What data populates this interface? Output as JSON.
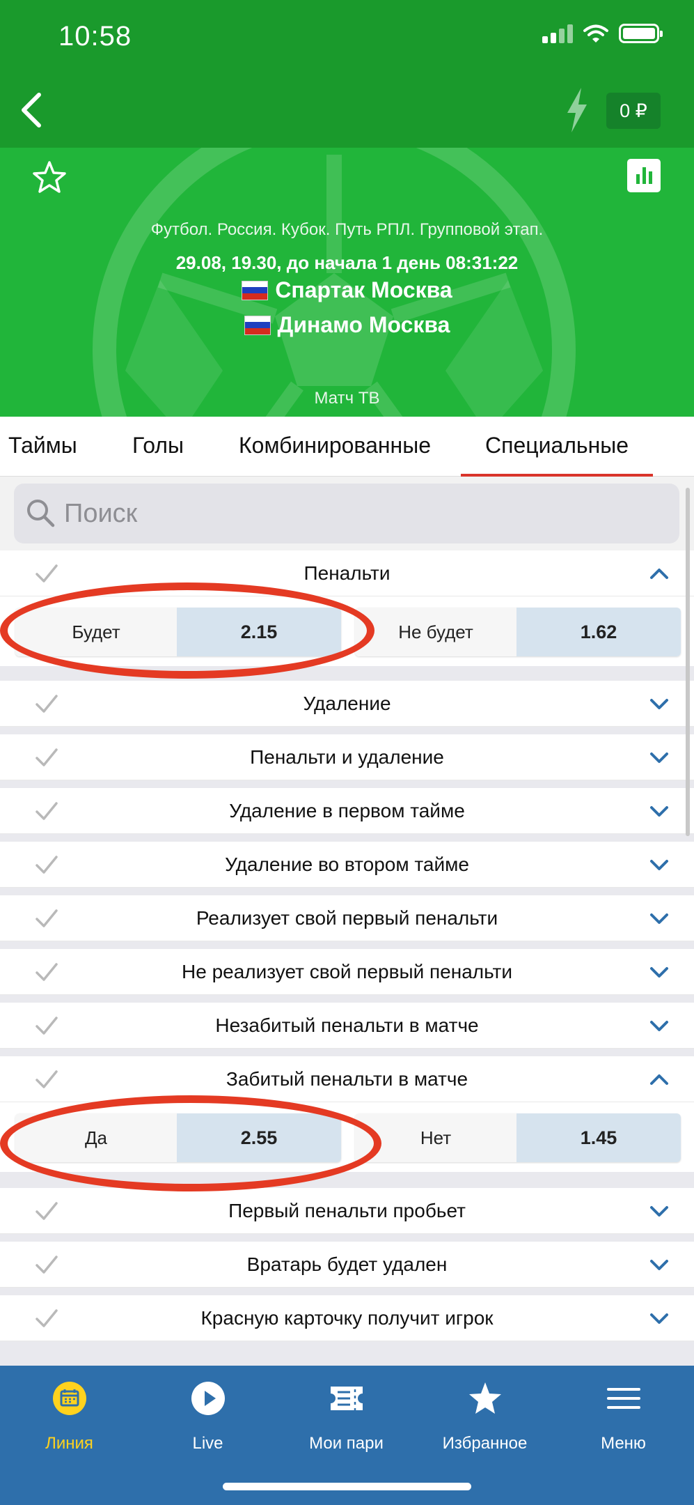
{
  "status_bar": {
    "time": "10:58"
  },
  "header": {
    "balance": "0 ₽"
  },
  "match": {
    "tournament": "Футбол. Россия. Кубок. Путь РПЛ. Групповой этап.",
    "datetime": "29.08, 19.30,  до начала 1 день 08:31:22",
    "team1": "Спартак Москва",
    "team2": "Динамо Москва",
    "tv": "Матч ТВ"
  },
  "tabs": [
    "Таймы",
    "Голы",
    "Комбинированные",
    "Специальные"
  ],
  "active_tab": "Специальные",
  "search": {
    "placeholder": "Поиск"
  },
  "markets": [
    {
      "title": "Пенальти",
      "expanded": true,
      "odds": [
        {
          "label": "Будет",
          "value": "2.15"
        },
        {
          "label": "Не будет",
          "value": "1.62"
        }
      ]
    },
    {
      "title": "Удаление",
      "expanded": false
    },
    {
      "title": "Пенальти и удаление",
      "expanded": false
    },
    {
      "title": "Удаление в первом тайме",
      "expanded": false
    },
    {
      "title": "Удаление во втором тайме",
      "expanded": false
    },
    {
      "title": "Реализует свой первый пенальти",
      "expanded": false
    },
    {
      "title": "Не реализует свой первый пенальти",
      "expanded": false
    },
    {
      "title": "Незабитый пенальти в матче",
      "expanded": false
    },
    {
      "title": "Забитый пенальти в матче",
      "expanded": true,
      "odds": [
        {
          "label": "Да",
          "value": "2.55"
        },
        {
          "label": "Нет",
          "value": "1.45"
        }
      ]
    },
    {
      "title": "Первый пенальти пробьет",
      "expanded": false
    },
    {
      "title": "Вратарь будет удален",
      "expanded": false
    },
    {
      "title": "Красную карточку получит игрок",
      "expanded": false
    }
  ],
  "bottom_nav": [
    {
      "label": "Линия",
      "icon": "calendar-icon",
      "active": true
    },
    {
      "label": "Live",
      "icon": "play-icon",
      "active": false
    },
    {
      "label": "Мои пари",
      "icon": "ticket-icon",
      "active": false
    },
    {
      "label": "Избранное",
      "icon": "star-icon",
      "active": false
    },
    {
      "label": "Меню",
      "icon": "menu-icon",
      "active": false
    }
  ],
  "colors": {
    "header_green": "#1a9a2c",
    "match_green": "#21b53a",
    "nav_blue": "#2e6fab",
    "active_yellow": "#ffd21e",
    "tab_underline": "#d9342b",
    "highlight_red": "#e43a23",
    "odds_blue": "#d6e3ee",
    "chevron_blue": "#2e6fab"
  }
}
